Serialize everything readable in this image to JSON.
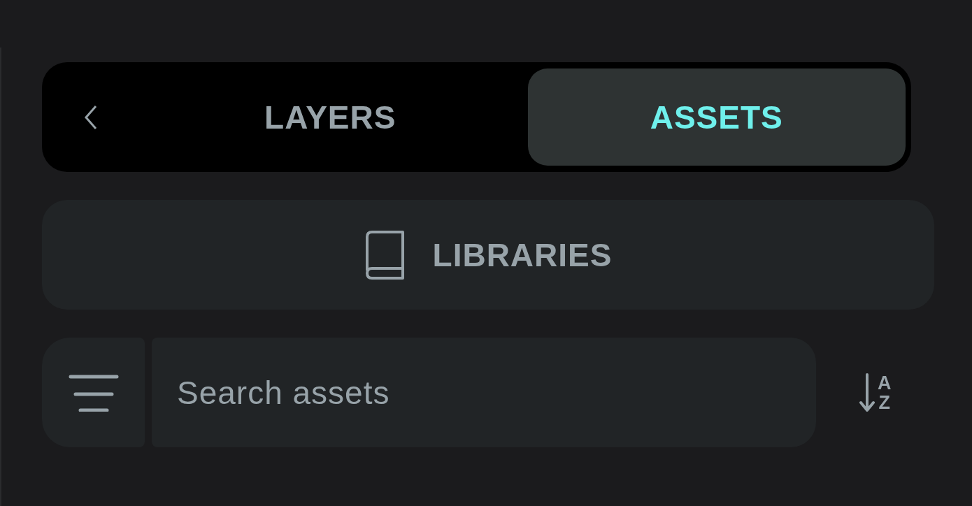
{
  "tabs": [
    {
      "label": "LAYERS",
      "selected": false
    },
    {
      "label": "ASSETS",
      "selected": true
    }
  ],
  "libraries_button": {
    "label": "LIBRARIES"
  },
  "search": {
    "placeholder": "Search assets"
  },
  "sort_button": {
    "top_letter": "A",
    "bottom_letter": "Z"
  }
}
